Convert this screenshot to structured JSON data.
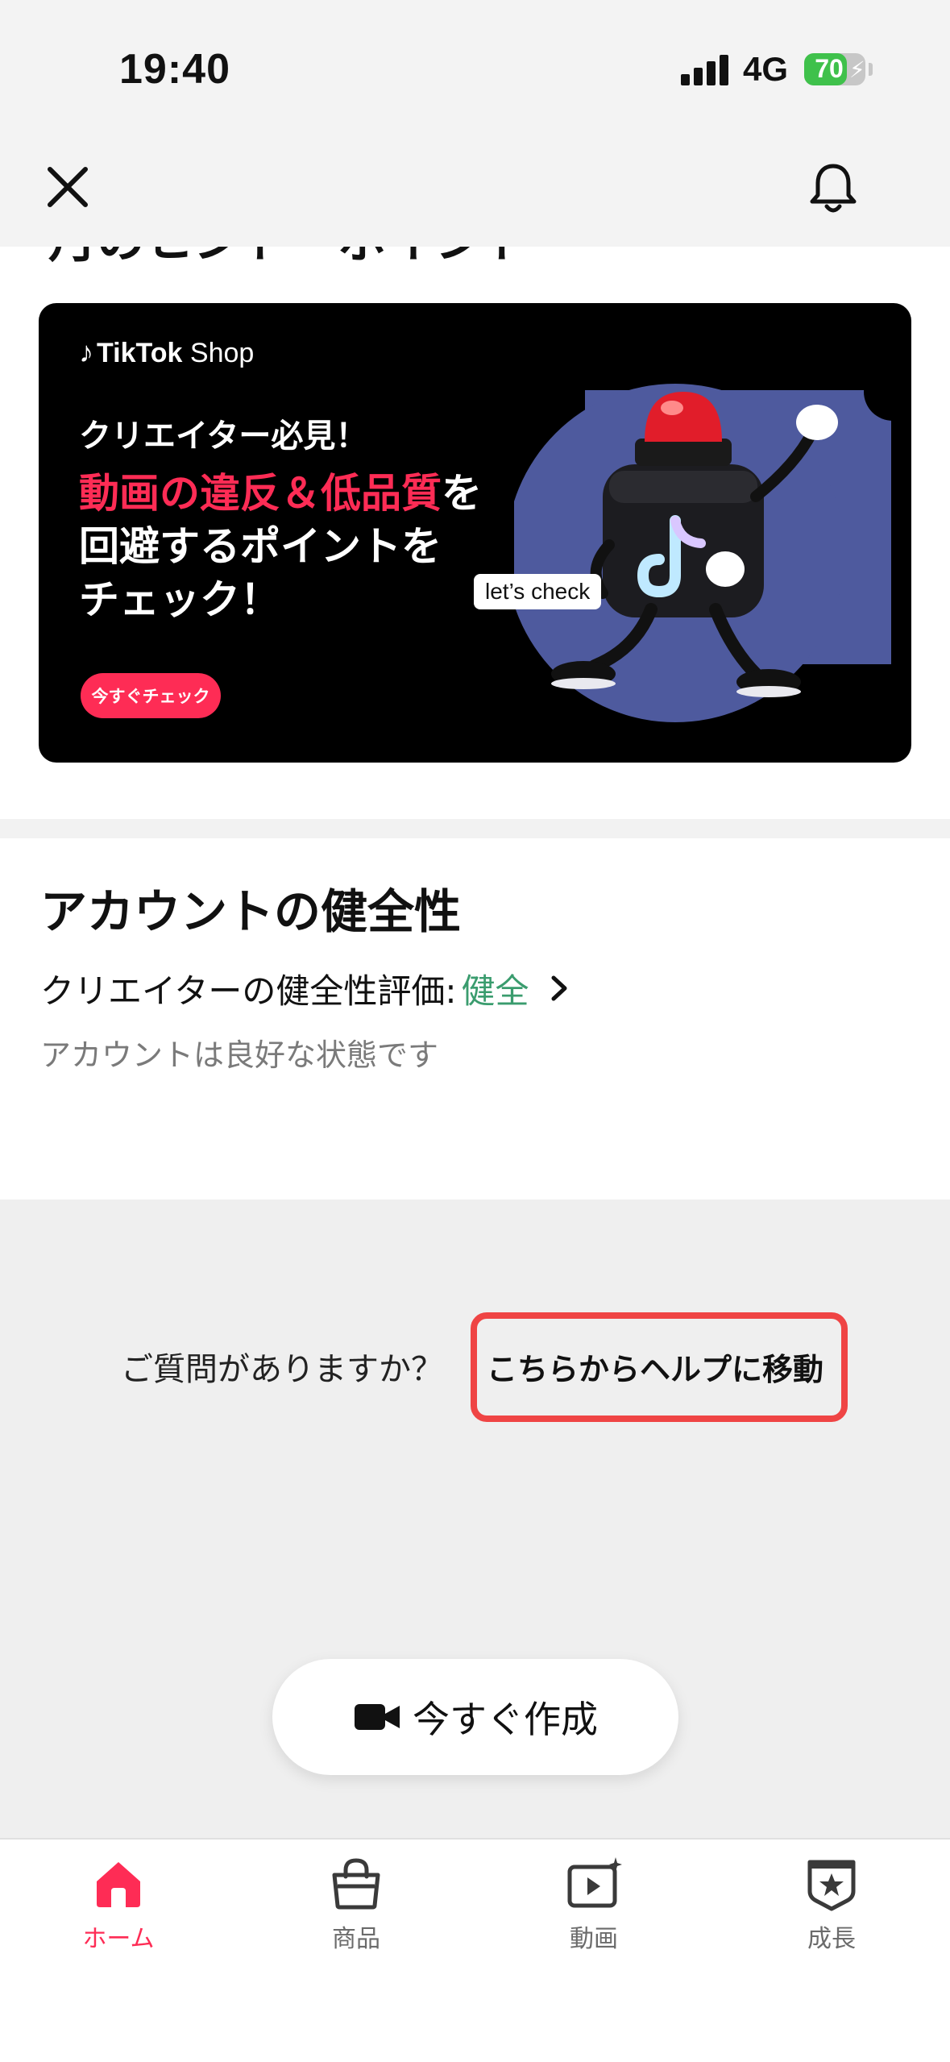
{
  "status_bar": {
    "time": "19:40",
    "network": "4G",
    "battery_level": 70,
    "battery_text": "70"
  },
  "nav": {
    "close_icon": "close-icon",
    "bell_icon": "bell-icon"
  },
  "clipped_heading": "月のヒント・ポイント",
  "banner": {
    "brand": "TikTok",
    "brand_suffix": "Shop",
    "line1": "クリエイター必見！",
    "line2_accent": "動画の違反＆低品質",
    "line2_rest": "を",
    "line3": "回避するポイントを",
    "line4": "チェック！",
    "cta": "今すぐチェック",
    "tag": "let’s check"
  },
  "health": {
    "title": "アカウントの健全性",
    "label": "クリエイターの健全性評価:",
    "status": "健全",
    "description": "アカウントは良好な状態です"
  },
  "help": {
    "question": "ご質問がありますか？",
    "link": "こちらからヘルプに移動"
  },
  "create_button": {
    "label": "今すぐ作成",
    "icon": "video-camera-icon"
  },
  "tabs": [
    {
      "label": "ホーム",
      "icon": "home-icon",
      "active": true
    },
    {
      "label": "商品",
      "icon": "shopping-bag-icon",
      "active": false
    },
    {
      "label": "動画",
      "icon": "video-play-icon",
      "active": false
    },
    {
      "label": "成長",
      "icon": "star-badge-icon",
      "active": false
    }
  ],
  "colors": {
    "accent": "#fe2c55",
    "healthy": "#3a9c6e",
    "highlight_border": "#ef4444"
  }
}
